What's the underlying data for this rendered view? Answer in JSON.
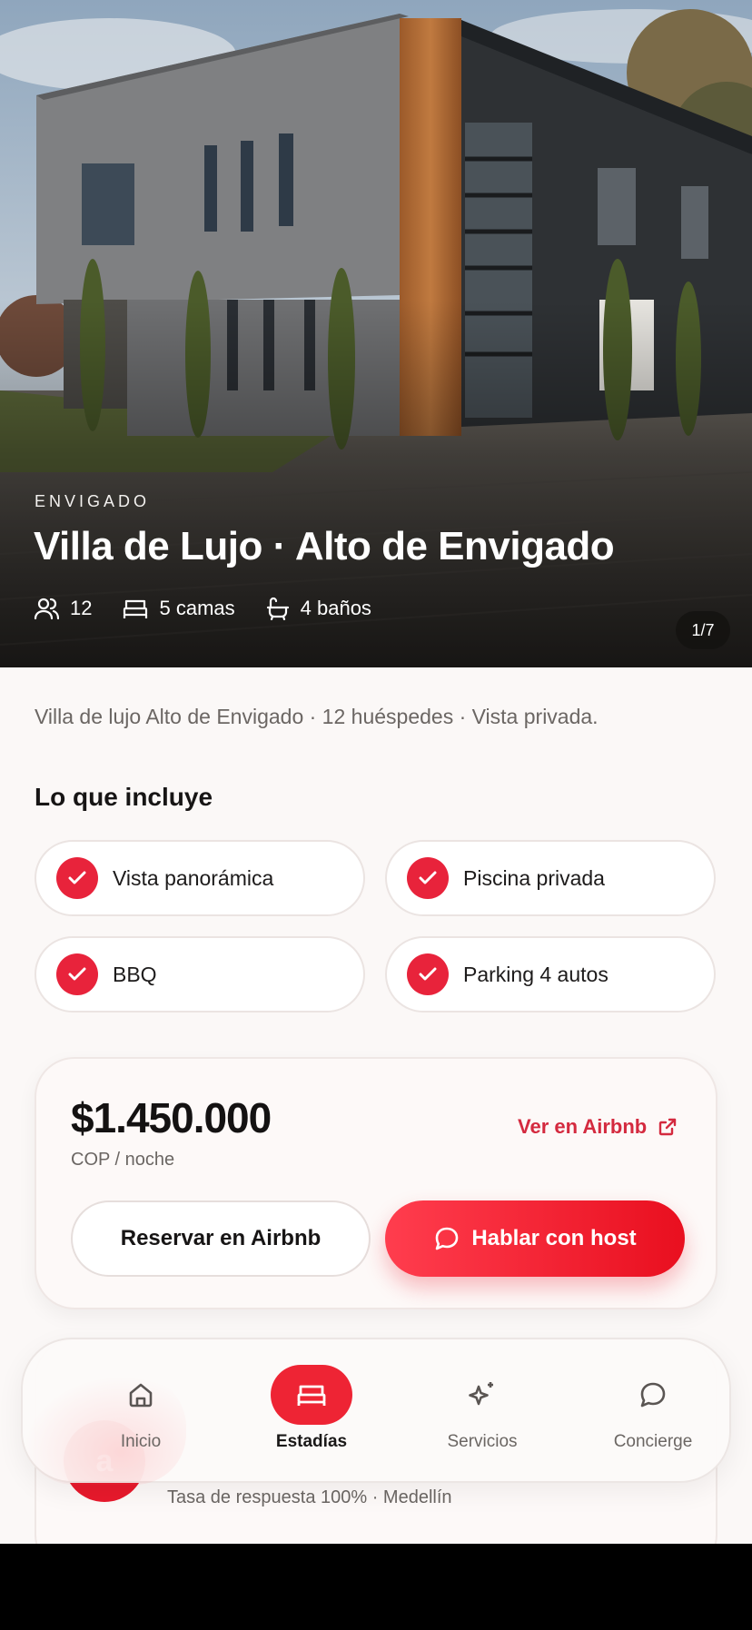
{
  "hero": {
    "city": "ENVIGADO",
    "title": "Villa de Lujo · Alto de Envigado",
    "guests": "12",
    "beds": "5 camas",
    "baths": "4 baños",
    "photo_counter": "1/7"
  },
  "description": "Villa de lujo Alto de Envigado · 12 huéspedes · Vista privada.",
  "includes": {
    "title": "Lo que incluye",
    "items": [
      {
        "label": "Vista panorámica"
      },
      {
        "label": "Piscina privada"
      },
      {
        "label": "BBQ"
      },
      {
        "label": "Parking 4 autos"
      }
    ]
  },
  "pricing": {
    "price": "$1.450.000",
    "unit": "COP / noche",
    "airbnb_link": "Ver en Airbnb",
    "reserve_button": "Reservar en Airbnb",
    "host_button": "Hablar con host"
  },
  "host": {
    "avatar_letter": "a",
    "info": "Tasa de respuesta 100% · Medellín"
  },
  "nav": {
    "items": [
      {
        "label": "Inicio",
        "icon": "home-icon"
      },
      {
        "label": "Estadías",
        "icon": "bed-icon",
        "active": true
      },
      {
        "label": "Servicios",
        "icon": "sparkles-icon"
      },
      {
        "label": "Concierge",
        "icon": "chat-icon"
      }
    ]
  },
  "colors": {
    "accent": "#ee2434",
    "link": "#d42a3f",
    "background": "#fbf8f7"
  }
}
